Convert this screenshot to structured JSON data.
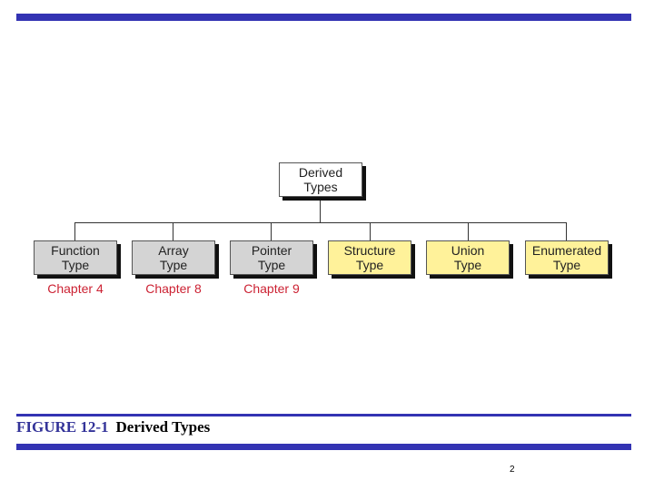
{
  "root": {
    "line1": "Derived",
    "line2": "Types"
  },
  "children": [
    {
      "line1": "Function",
      "line2": "Type",
      "chapter": "Chapter 4",
      "color": "gray"
    },
    {
      "line1": "Array",
      "line2": "Type",
      "chapter": "Chapter 8",
      "color": "gray"
    },
    {
      "line1": "Pointer",
      "line2": "Type",
      "chapter": "Chapter 9",
      "color": "gray"
    },
    {
      "line1": "Structure",
      "line2": "Type",
      "chapter": "",
      "color": "yellow"
    },
    {
      "line1": "Union",
      "line2": "Type",
      "chapter": "",
      "color": "yellow"
    },
    {
      "line1": "Enumerated",
      "line2": "Type",
      "chapter": "",
      "color": "yellow"
    }
  ],
  "caption": {
    "figure": "FIGURE 12-1",
    "title": "Derived Types"
  },
  "page_number": "2",
  "colors": {
    "accent_bar": "#3333b3",
    "chapter_text": "#cc2233",
    "gray_box": "#d4d4d4",
    "yellow_box": "#fff29a"
  }
}
